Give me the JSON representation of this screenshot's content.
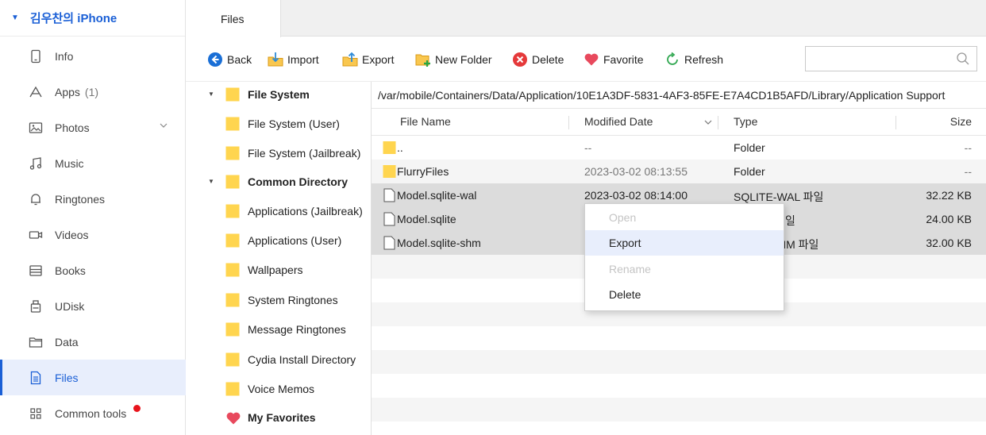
{
  "device": {
    "name": "김우찬의 iPhone"
  },
  "sidebar": {
    "items": [
      {
        "label": "Info",
        "icon": "phone-icon"
      },
      {
        "label": "Apps",
        "count": "(1)",
        "icon": "apps-icon"
      },
      {
        "label": "Photos",
        "icon": "photos-icon"
      },
      {
        "label": "Music",
        "icon": "music-icon"
      },
      {
        "label": "Ringtones",
        "icon": "bell-icon"
      },
      {
        "label": "Videos",
        "icon": "video-icon"
      },
      {
        "label": "Books",
        "icon": "book-icon"
      },
      {
        "label": "UDisk",
        "icon": "udisk-icon"
      },
      {
        "label": "Data",
        "icon": "folder-outline-icon"
      },
      {
        "label": "Files",
        "icon": "file-icon"
      },
      {
        "label": "Common tools",
        "icon": "grid-icon"
      }
    ]
  },
  "tabs": {
    "files": "Files"
  },
  "toolbar": {
    "back": "Back",
    "import": "Import",
    "export": "Export",
    "new_folder": "New Folder",
    "delete": "Delete",
    "favorite": "Favorite",
    "refresh": "Refresh",
    "search_placeholder": ""
  },
  "tree": {
    "file_system": "File System",
    "file_system_user": "File System (User)",
    "file_system_jailbreak": "File System (Jailbreak)",
    "common_directory": "Common Directory",
    "apps_jailbreak": "Applications (Jailbreak)",
    "apps_user": "Applications (User)",
    "wallpapers": "Wallpapers",
    "system_ringtones": "System Ringtones",
    "message_ringtones": "Message Ringtones",
    "cydia": "Cydia Install Directory",
    "voice_memos": "Voice Memos",
    "my_favorites": "My Favorites"
  },
  "path": "/var/mobile/Containers/Data/Application/10E1A3DF-5831-4AF3-85FE-E7A4CD1B5AFD/Library/Application Support",
  "columns": {
    "name": "File Name",
    "modified": "Modified Date",
    "type": "Type",
    "size": "Size"
  },
  "rows": [
    {
      "name": "..",
      "modified": "--",
      "type": "Folder",
      "size": "--"
    },
    {
      "name": "FlurryFiles",
      "modified": "2023-03-02 08:13:55",
      "type": "Folder",
      "size": "--"
    },
    {
      "name": "Model.sqlite-wal",
      "modified": "2023-03-02 08:14:00",
      "type": "SQLITE-WAL 파일",
      "size": "32.22 KB"
    },
    {
      "name": "Model.sqlite",
      "modified": "",
      "type": "일",
      "size": "24.00 KB"
    },
    {
      "name": "Model.sqlite-shm",
      "modified": "",
      "type": "HM 파일",
      "size": "32.00 KB"
    }
  ],
  "context_menu": {
    "open": "Open",
    "export": "Export",
    "rename": "Rename",
    "delete": "Delete"
  },
  "colors": {
    "accent": "#1a5fd6",
    "selection": "#dcdcdc",
    "folder": "#ffd54f"
  }
}
